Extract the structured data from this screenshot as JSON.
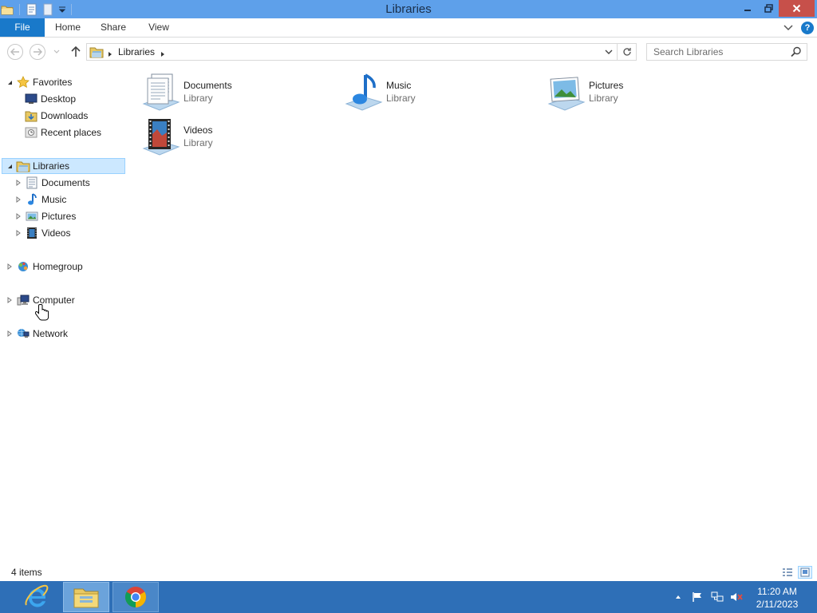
{
  "window": {
    "title": "Libraries"
  },
  "ribbon": {
    "tabs": [
      {
        "label": "File"
      },
      {
        "label": "Home"
      },
      {
        "label": "Share"
      },
      {
        "label": "View"
      }
    ],
    "help_label": "?"
  },
  "navbar": {
    "breadcrumb": [
      "Libraries"
    ],
    "search_placeholder": "Search Libraries"
  },
  "nav_pane": {
    "favorites": {
      "label": "Favorites",
      "items": [
        {
          "label": "Desktop",
          "icon": "desktop-icon"
        },
        {
          "label": "Downloads",
          "icon": "downloads-icon"
        },
        {
          "label": "Recent places",
          "icon": "recent-places-icon"
        }
      ]
    },
    "libraries": {
      "label": "Libraries",
      "selected": true,
      "items": [
        {
          "label": "Documents",
          "icon": "documents-icon"
        },
        {
          "label": "Music",
          "icon": "music-icon"
        },
        {
          "label": "Pictures",
          "icon": "pictures-icon"
        },
        {
          "label": "Videos",
          "icon": "videos-icon"
        }
      ]
    },
    "homegroup": {
      "label": "Homegroup"
    },
    "computer": {
      "label": "Computer"
    },
    "network": {
      "label": "Network"
    }
  },
  "content": {
    "libraries": [
      {
        "name": "Documents",
        "kind": "Library",
        "icon": "documents-library-icon"
      },
      {
        "name": "Music",
        "kind": "Library",
        "icon": "music-library-icon"
      },
      {
        "name": "Pictures",
        "kind": "Library",
        "icon": "pictures-library-icon"
      },
      {
        "name": "Videos",
        "kind": "Library",
        "icon": "videos-library-icon"
      }
    ]
  },
  "status_bar": {
    "item_count": "4 items"
  },
  "taskbar": {
    "apps": [
      {
        "name": "Internet Explorer",
        "icon": "internet-explorer-icon"
      },
      {
        "name": "File Explorer",
        "icon": "file-explorer-icon",
        "active": true
      },
      {
        "name": "Google Chrome",
        "icon": "chrome-icon"
      }
    ],
    "clock": {
      "time": "11:20 AM",
      "date": "2/11/2023"
    }
  },
  "colors": {
    "titlebar": "#5ea0ea",
    "file_tab": "#1979ca",
    "close_button": "#c7504a",
    "selection": "#cce8ff",
    "taskbar": "#2e6fb7"
  }
}
